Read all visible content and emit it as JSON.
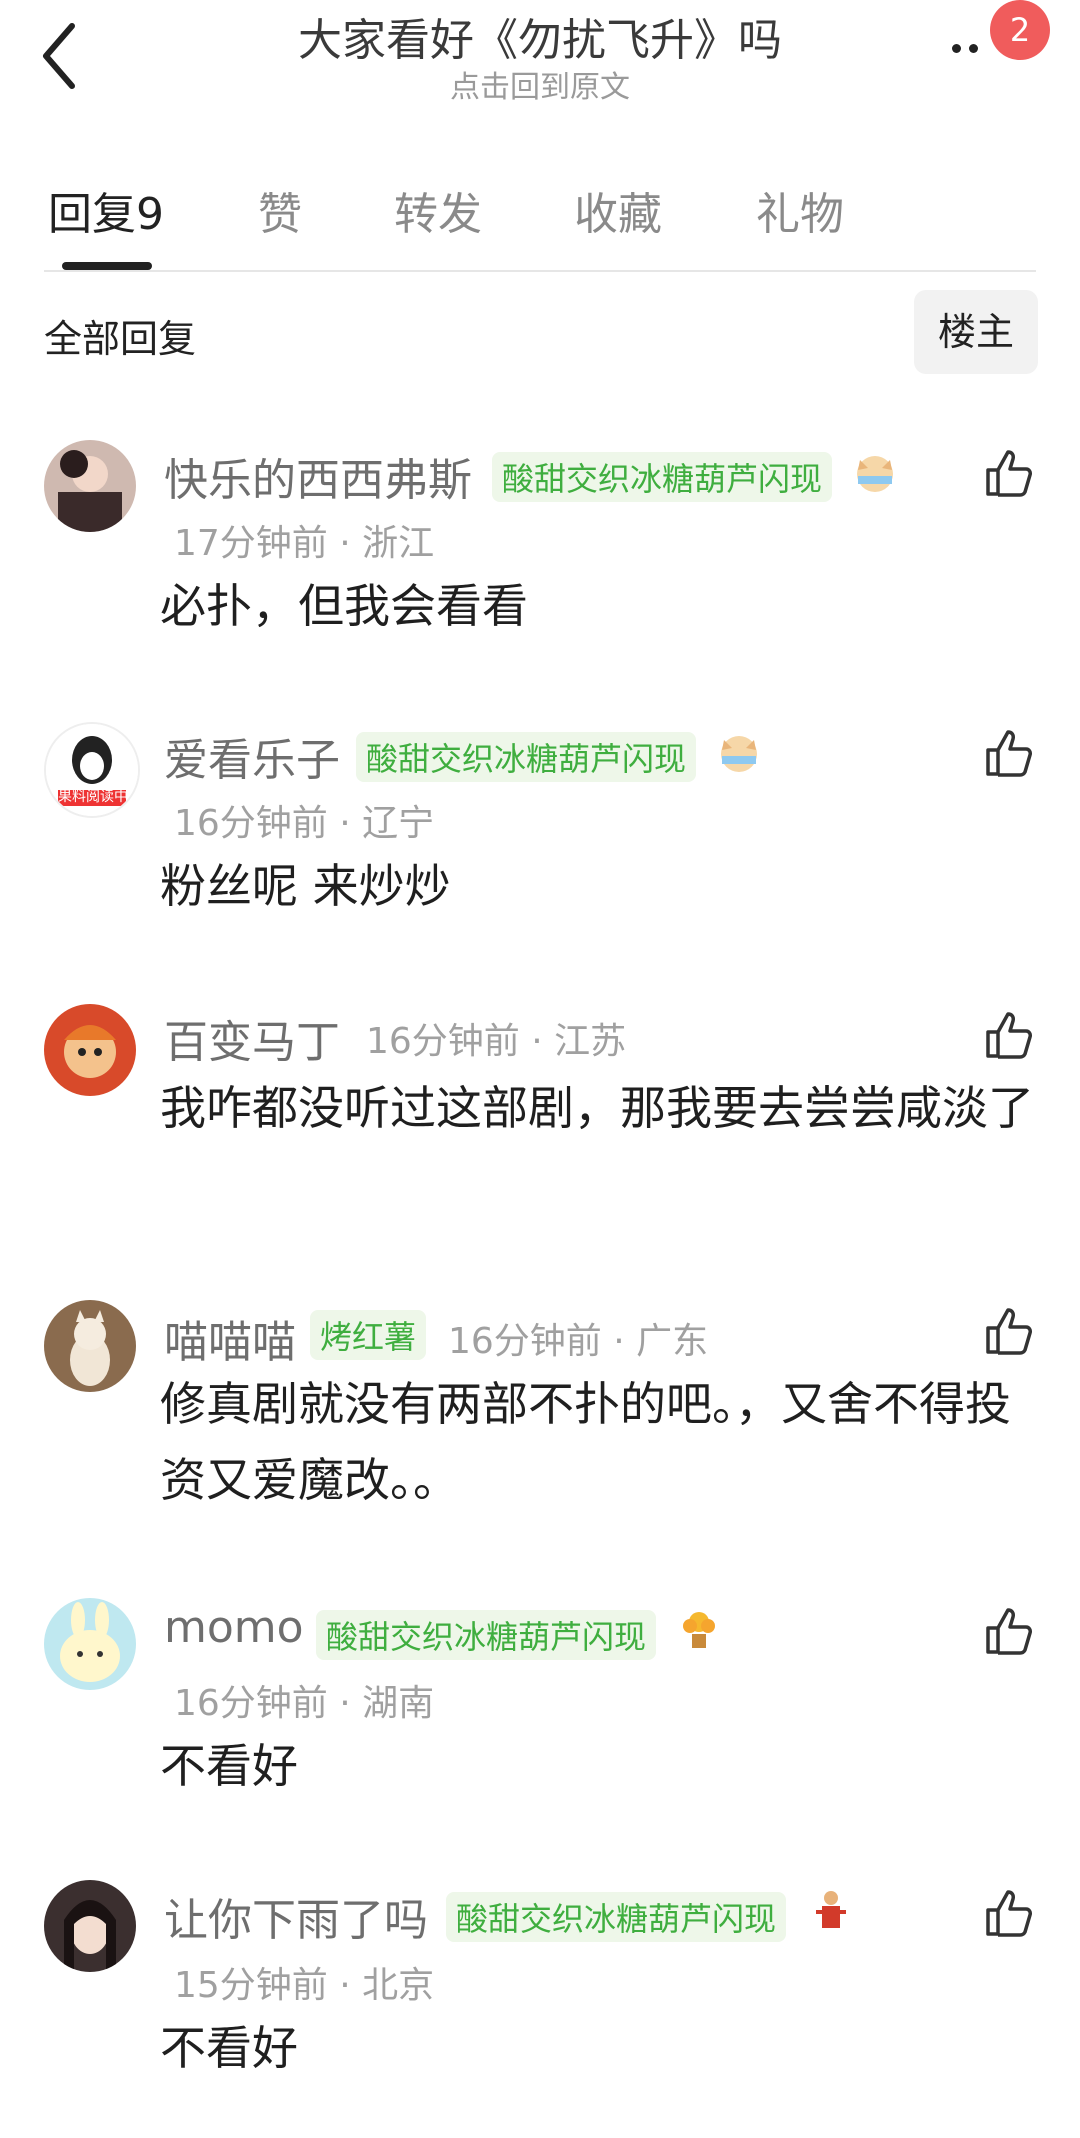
{
  "header": {
    "title": "大家看好《勿扰飞升》吗",
    "subtitle": "点击回到原文",
    "notification_count": "2"
  },
  "tabs": [
    {
      "label": "回复9",
      "active": true
    },
    {
      "label": "赞",
      "active": false
    },
    {
      "label": "转发",
      "active": false
    },
    {
      "label": "收藏",
      "active": false
    },
    {
      "label": "礼物",
      "active": false
    }
  ],
  "filter": {
    "all_replies_label": "全部回复",
    "owner_label": "楼主"
  },
  "comments": [
    {
      "username": "快乐的西西弗斯",
      "medal": "酸甜交织冰糖葫芦闪现",
      "time": "17分钟前",
      "location": "浙江",
      "text": "必扑，但我会看看"
    },
    {
      "username": "爱看乐子",
      "medal": "酸甜交织冰糖葫芦闪现",
      "time": "16分钟前",
      "location": "辽宁",
      "text": "粉丝呢 来炒炒",
      "avatar_text": "果料阅读中"
    },
    {
      "username": "百变马丁",
      "medal": "",
      "time": "16分钟前",
      "location": "江苏",
      "text": "我咋都没听过这部剧，那我要去尝尝咸淡了"
    },
    {
      "username": "喵喵喵",
      "medal": "烤红薯",
      "time": "16分钟前",
      "location": "广东",
      "text": "修真剧就没有两部不扑的吧。，又舍不得投资又爱魔改。。"
    },
    {
      "username": "momo",
      "medal": "酸甜交织冰糖葫芦闪现",
      "time": "16分钟前",
      "location": "湖南",
      "text": "不看好"
    },
    {
      "username": "让你下雨了吗",
      "medal": "酸甜交织冰糖葫芦闪现",
      "time": "15分钟前",
      "location": "北京",
      "text": "不看好"
    }
  ],
  "separator": " · ",
  "colors": {
    "medal_green": "#3fae3f",
    "badge_red": "#f05c5c"
  }
}
